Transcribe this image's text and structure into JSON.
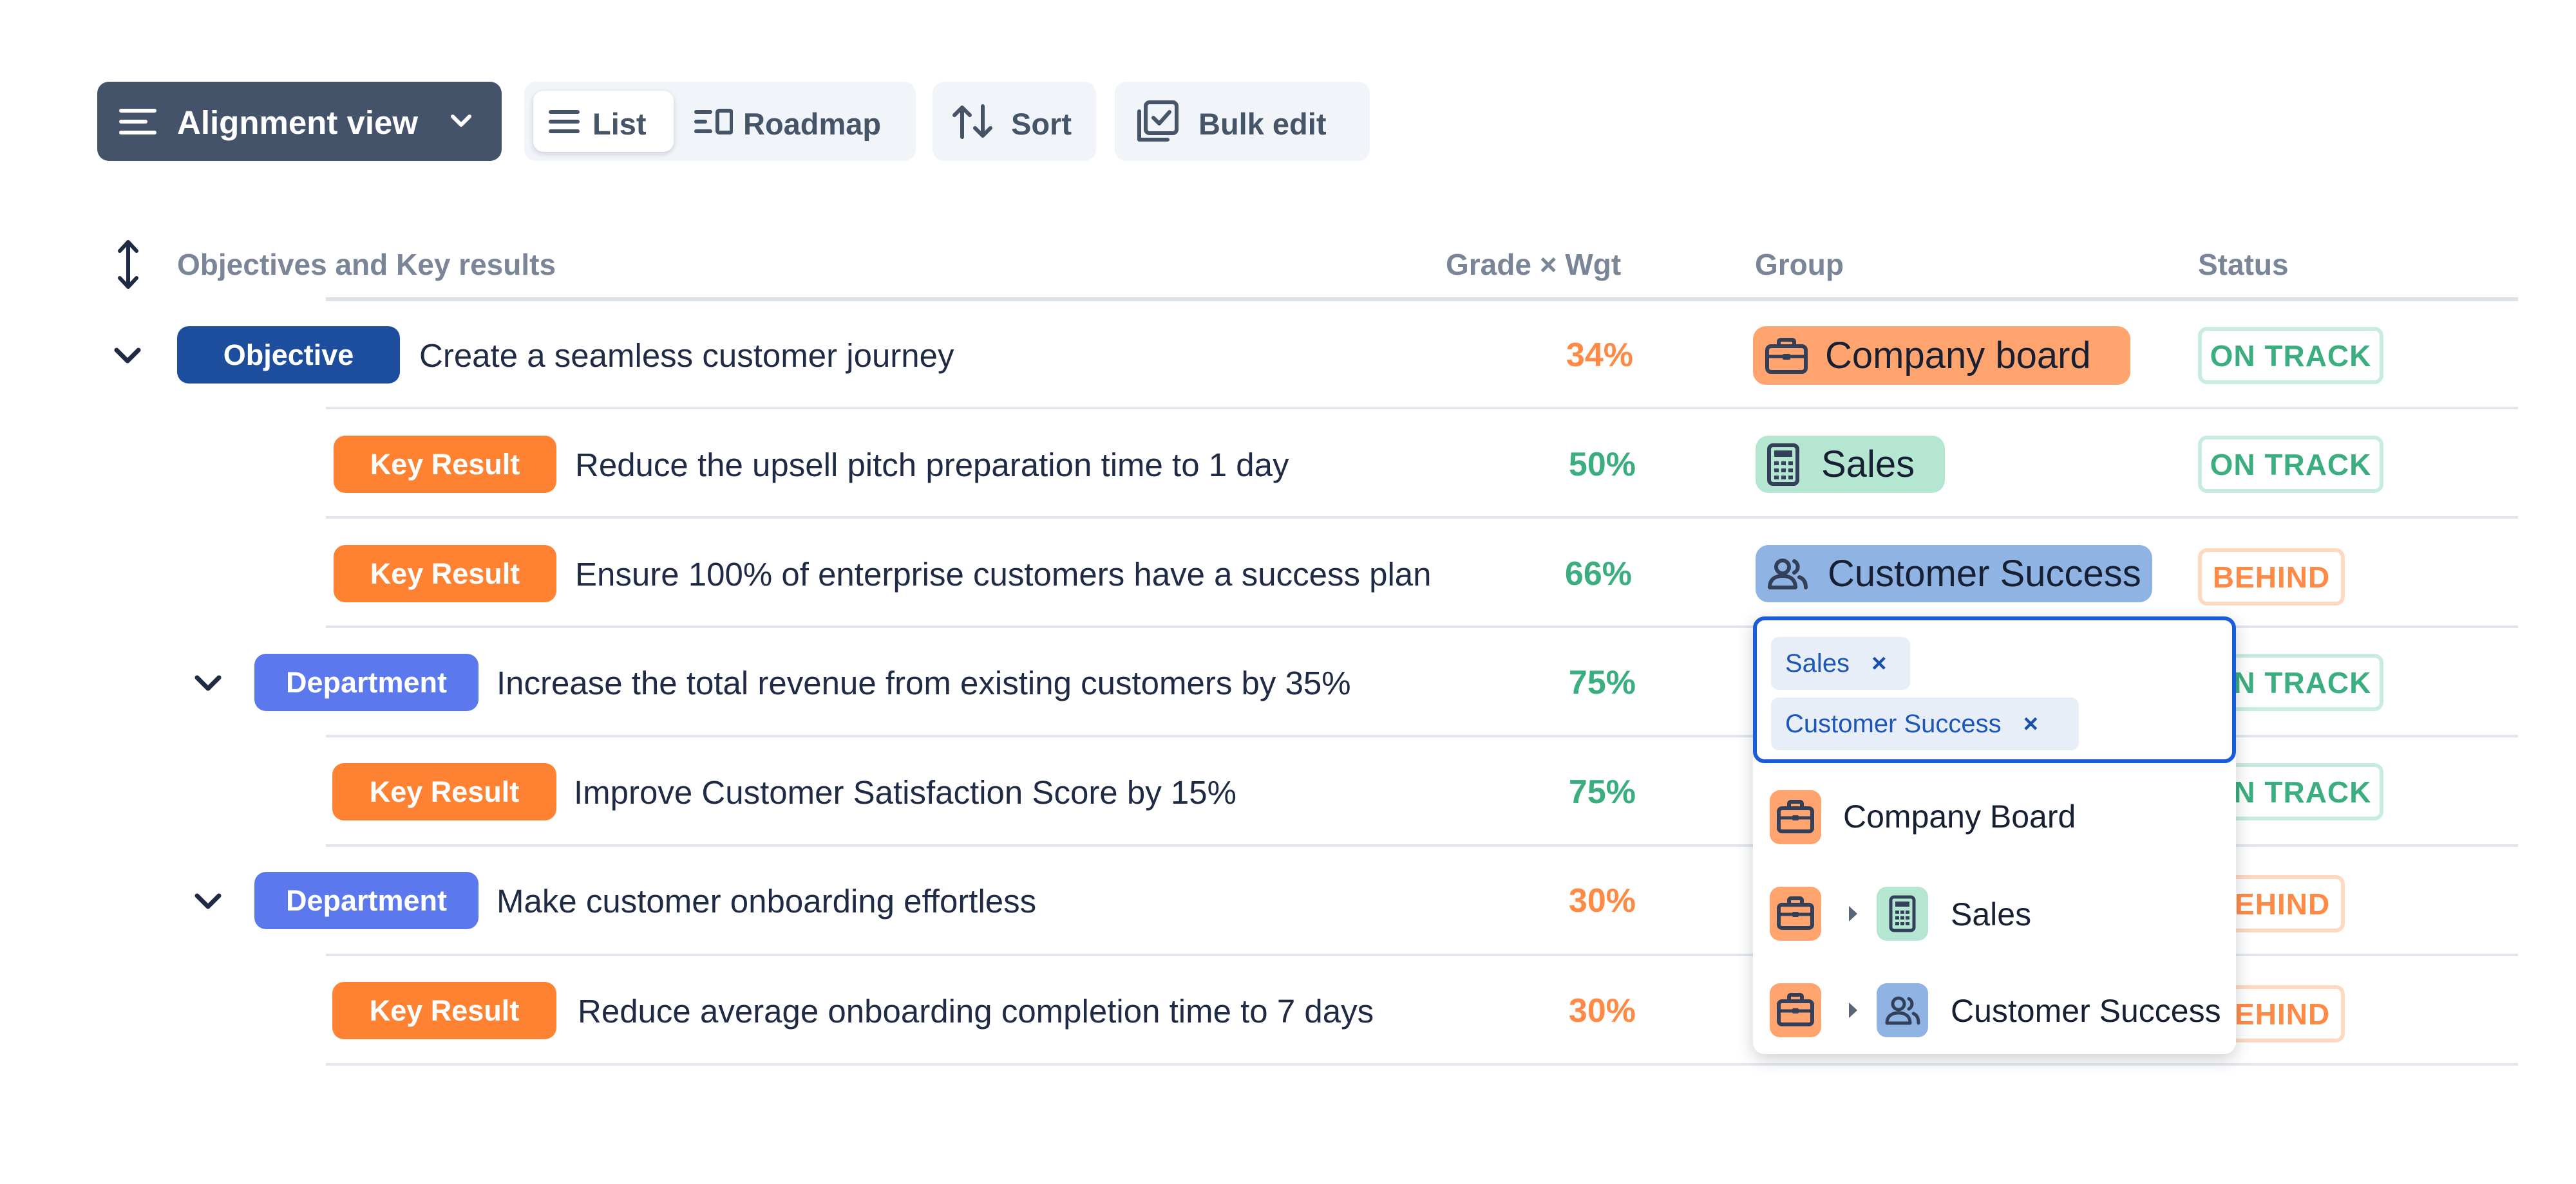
{
  "toolbar": {
    "alignment_view": "Alignment view",
    "list": "List",
    "roadmap": "Roadmap",
    "sort": "Sort",
    "bulk_edit": "Bulk edit"
  },
  "table": {
    "headers": {
      "okr": "Objectives and Key results",
      "grade": "Grade × Wgt",
      "group": "Group",
      "status": "Status"
    },
    "rows": [
      {
        "type": "Objective",
        "title": "Create a seamless customer journey",
        "grade": "34%",
        "group": "Company board",
        "status": "ON TRACK"
      },
      {
        "type": "Key Result",
        "title": "Reduce the upsell pitch preparation time to 1 day",
        "grade": "50%",
        "group": "Sales",
        "status": "ON TRACK"
      },
      {
        "type": "Key Result",
        "title": "Ensure 100% of enterprise customers have a success plan",
        "grade": "66%",
        "group": "Customer Success",
        "status": "BEHIND"
      },
      {
        "type": "Department",
        "title": "Increase the total revenue from existing customers by 35%",
        "grade": "75%",
        "group": "",
        "status": "ON TRACK"
      },
      {
        "type": "Key Result",
        "title": "Improve Customer Satisfaction Score by 15%",
        "grade": "75%",
        "group": "",
        "status": "ON TRACK"
      },
      {
        "type": "Department",
        "title": "Make customer onboarding effortless",
        "grade": "30%",
        "group": "",
        "status": "BEHIND"
      },
      {
        "type": "Key Result",
        "title": "Reduce average onboarding completion time to 7 days",
        "grade": "30%",
        "group": "",
        "status": "BEHIND"
      }
    ]
  },
  "group_picker": {
    "selected": [
      "Sales",
      "Customer Success"
    ],
    "remove_glyph": "×",
    "options": [
      "Company Board",
      "Sales",
      "Customer Success"
    ]
  },
  "colors": {
    "objective": "#1d4e9e",
    "key_result": "#ff8233",
    "department": "#5b79ec",
    "on_track": "#3aae7e",
    "behind": "#ff8a45",
    "company_board": "#ffa46e",
    "sales": "#b5e6d2",
    "customer_success": "#8fb4e3",
    "focus": "#1a5bd8"
  },
  "icons": {
    "company_board": "briefcase-icon",
    "sales": "calculator-icon",
    "customer_success": "people-icon"
  }
}
